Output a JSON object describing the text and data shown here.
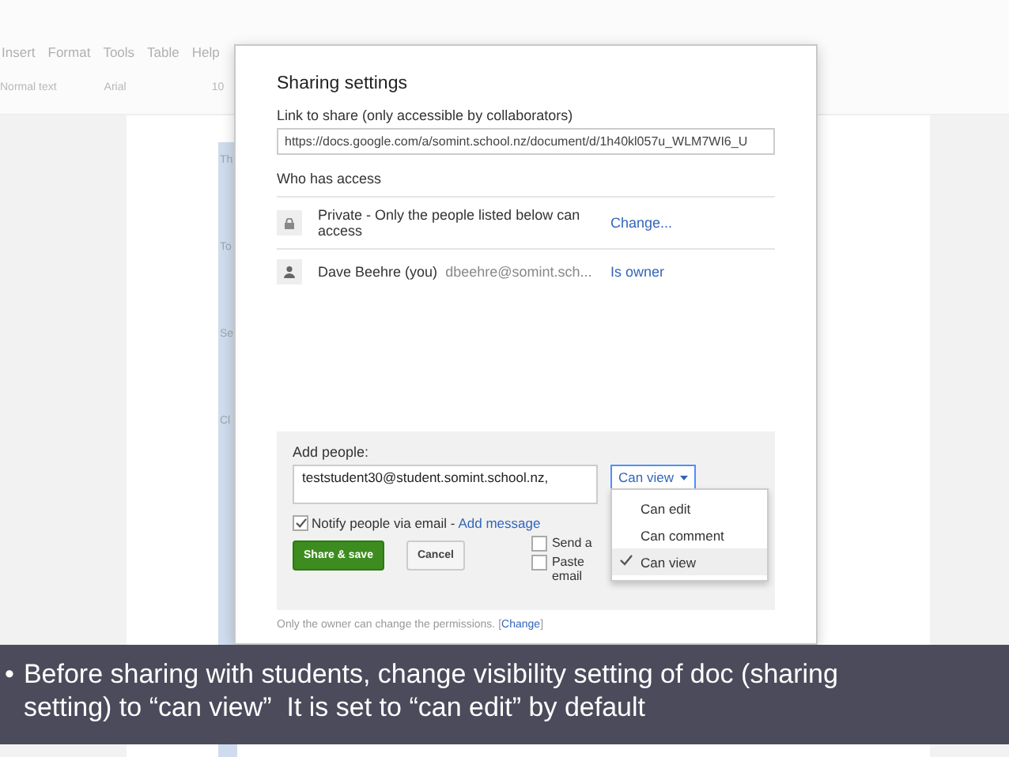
{
  "menu_bar": [
    "Insert",
    "Format",
    "Tools",
    "Table",
    "Help"
  ],
  "toolbar": {
    "style": "Normal text",
    "font": "Arial",
    "size": "10"
  },
  "document": {
    "table_cells": [
      "Th",
      "To",
      "Se",
      "Cl"
    ]
  },
  "dialog": {
    "title": "Sharing settings",
    "link_label": "Link to share (only accessible by collaborators)",
    "link_url": "https://docs.google.com/a/somint.school.nz/document/d/1h40kl057u_WLM7WI6_U",
    "access_label": "Who has access",
    "access": [
      {
        "kind": "visibility",
        "text": "Private - Only the people listed below can access",
        "action": "Change..."
      },
      {
        "kind": "person",
        "name": "Dave Beehre (you)",
        "email": "dbeehre@somint.sch...",
        "action": "Is owner"
      }
    ],
    "add_people": {
      "label": "Add people:",
      "value": "teststudent30@student.somint.school.nz,",
      "permission": "Can view",
      "menu": [
        {
          "label": "Can edit",
          "selected": false
        },
        {
          "label": "Can comment",
          "selected": false
        },
        {
          "label": "Can view",
          "selected": true
        }
      ],
      "notify": {
        "checked": true,
        "label": "Notify people via email -",
        "link": "Add message"
      },
      "options": [
        {
          "checked": false,
          "lines": [
            "Send a"
          ]
        },
        {
          "checked": false,
          "lines": [
            "Paste",
            "email"
          ]
        }
      ],
      "buttons": [
        {
          "kind": "primary",
          "label": "Share & save"
        },
        {
          "kind": "secondary",
          "label": "Cancel"
        }
      ]
    },
    "footer": {
      "before": "Only the owner can change the permissions. [",
      "link": "Change",
      "after": "]"
    }
  },
  "caption": {
    "bullet": "•",
    "text": "Before sharing with students, change visibility setting of doc (sharing setting) to “can view”  It is set to “can edit” by default"
  }
}
